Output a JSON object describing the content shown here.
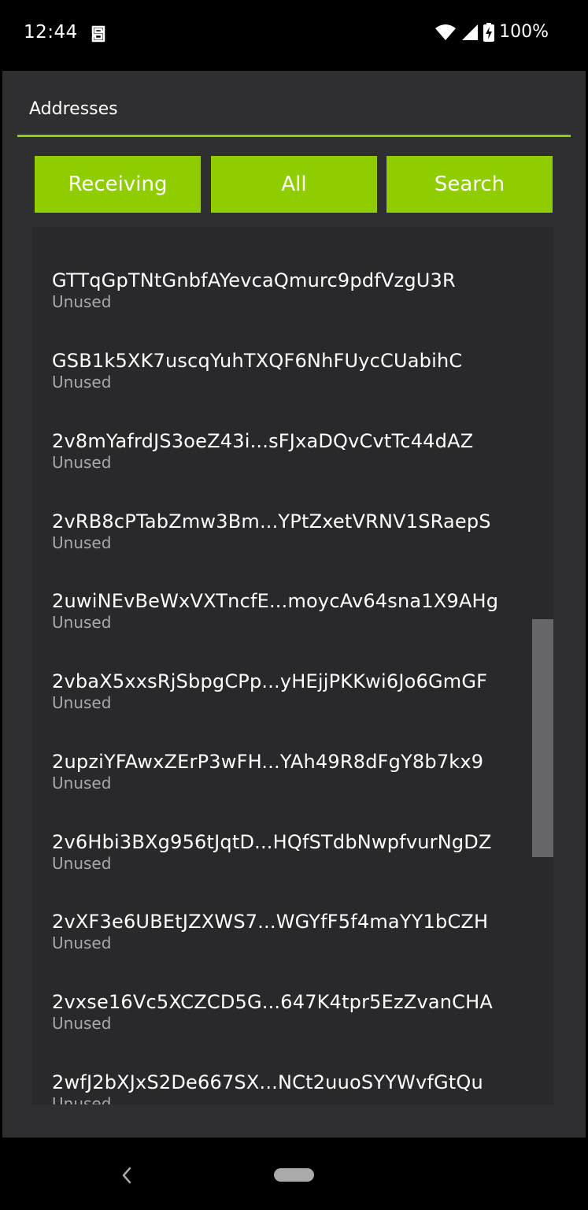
{
  "status_bar": {
    "time": "12:44",
    "battery": "100%",
    "icons": [
      "app-notification-icon",
      "wifi-icon",
      "signal-icon",
      "battery-charging-icon"
    ]
  },
  "header": {
    "title": "Addresses"
  },
  "tabs": [
    {
      "label": "Receiving"
    },
    {
      "label": "All"
    },
    {
      "label": "Search"
    }
  ],
  "addresses": [
    {
      "address": "GTTqGpTNtGnbfAYevcaQmurc9pdfVzgU3R",
      "status": "Unused"
    },
    {
      "address": "GSB1k5XK7uscqYuhTXQF6NhFUycCUabihC",
      "status": "Unused"
    },
    {
      "address": "2v8mYafrdJS3oeZ43i...sFJxaDQvCvtTc44dAZ",
      "status": "Unused"
    },
    {
      "address": "2vRB8cPTabZmw3Bm...YPtZxetVRNV1SRaepS",
      "status": "Unused"
    },
    {
      "address": "2uwiNEvBeWxVXTncfE...moycAv64sna1X9AHg",
      "status": "Unused"
    },
    {
      "address": "2vbaX5xxsRjSbpgCPp...yHEjjPKKwi6Jo6GmGF",
      "status": "Unused"
    },
    {
      "address": "2upziYFAwxZErP3wFH...YAh49R8dFgY8b7kx9",
      "status": "Unused"
    },
    {
      "address": "2v6Hbi3BXg956tJqtD...HQfSTdbNwpfvurNgDZ",
      "status": "Unused"
    },
    {
      "address": "2vXF3e6UBEtJZXWS7...WGYfF5f4maYY1bCZH",
      "status": "Unused"
    },
    {
      "address": "2vxse16Vc5XCZCD5G...647K4tpr5EzZvanCHA",
      "status": "Unused"
    },
    {
      "address": "2wfJ2bXJxS2De667SX...NCt2uuoSYYWvfGtQu",
      "status": "Unused"
    }
  ],
  "colors": {
    "accent": "#8fcd00",
    "panel_bg": "#2f2f31",
    "list_bg": "#29292b",
    "secondary_text": "#a9a9ab"
  }
}
